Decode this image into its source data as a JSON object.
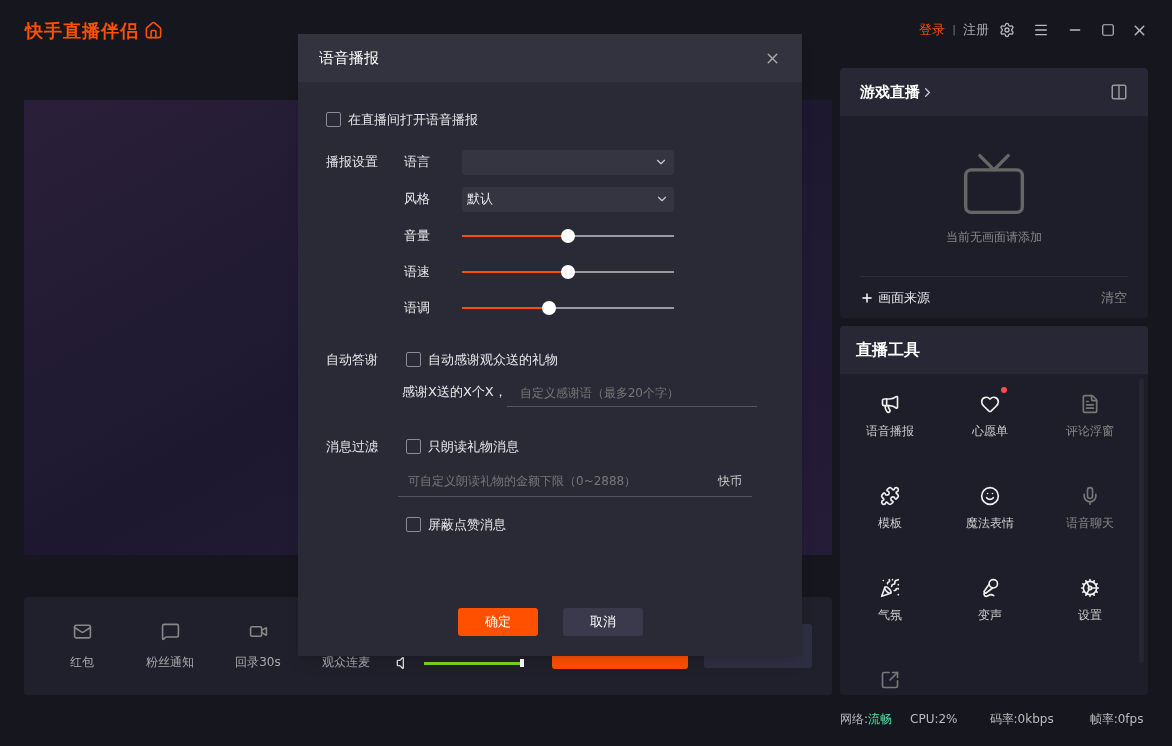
{
  "app": {
    "logo": "快手直播伴侣"
  },
  "header": {
    "login": "登录",
    "separator": "|",
    "register": "注册"
  },
  "bottom_toolbar": {
    "items": [
      {
        "label": "红包"
      },
      {
        "label": "粉丝通知"
      },
      {
        "label": "回录30s"
      },
      {
        "label": "观众连麦"
      }
    ],
    "mic": {
      "level": 1
    }
  },
  "scene_panel": {
    "title": "游戏直播",
    "empty_text": "当前无画面请添加",
    "add_source": "画面来源",
    "clear": "清空"
  },
  "tools_panel": {
    "title": "直播工具",
    "items": [
      {
        "label": "语音播报",
        "dimmed": false,
        "badge": false
      },
      {
        "label": "心愿单",
        "dimmed": false,
        "badge": true
      },
      {
        "label": "评论浮窗",
        "dimmed": true,
        "badge": false
      },
      {
        "label": "模板",
        "dimmed": false,
        "badge": false
      },
      {
        "label": "魔法表情",
        "dimmed": false,
        "badge": false
      },
      {
        "label": "语音聊天",
        "dimmed": true,
        "badge": false
      },
      {
        "label": "气氛",
        "dimmed": false,
        "badge": false
      },
      {
        "label": "变声",
        "dimmed": false,
        "badge": false
      },
      {
        "label": "设置",
        "dimmed": false,
        "badge": false
      },
      {
        "dimmed": true,
        "badge": false
      }
    ]
  },
  "status_bar": {
    "network_label": "网络:",
    "network_value": "流畅",
    "cpu": "CPU:2%",
    "bitrate": "码率:0kbps",
    "fps": "帧率:0fps"
  },
  "dialog": {
    "title": "语音播报",
    "enable": {
      "label": "在直播间打开语音播报",
      "checked": false
    },
    "settings": {
      "label": "播报设置",
      "language": {
        "label": "语言"
      },
      "style": {
        "label": "风格",
        "value": "默认"
      },
      "sliders": [
        {
          "label": "音量",
          "level": 0.5
        },
        {
          "label": "语速",
          "level": 0.5
        },
        {
          "label": "语调",
          "level": 0.41
        }
      ]
    },
    "thanks": {
      "label": "自动答谢",
      "checkbox": {
        "label": "自动感谢观众送的礼物",
        "checked": false
      },
      "prefix": "感谢X送的X个X，",
      "placeholder": "自定义感谢语（最多20个字）"
    },
    "filter": {
      "label": "消息过滤",
      "gift_only": {
        "label": "只朗读礼物消息",
        "checked": false
      },
      "placeholder": "可自定义朗读礼物的金额下限（0~2888）",
      "unit": "快币",
      "block_likes": {
        "label": "屏蔽点赞消息",
        "checked": false
      }
    },
    "buttons": {
      "ok": "确定",
      "cancel": "取消"
    }
  }
}
